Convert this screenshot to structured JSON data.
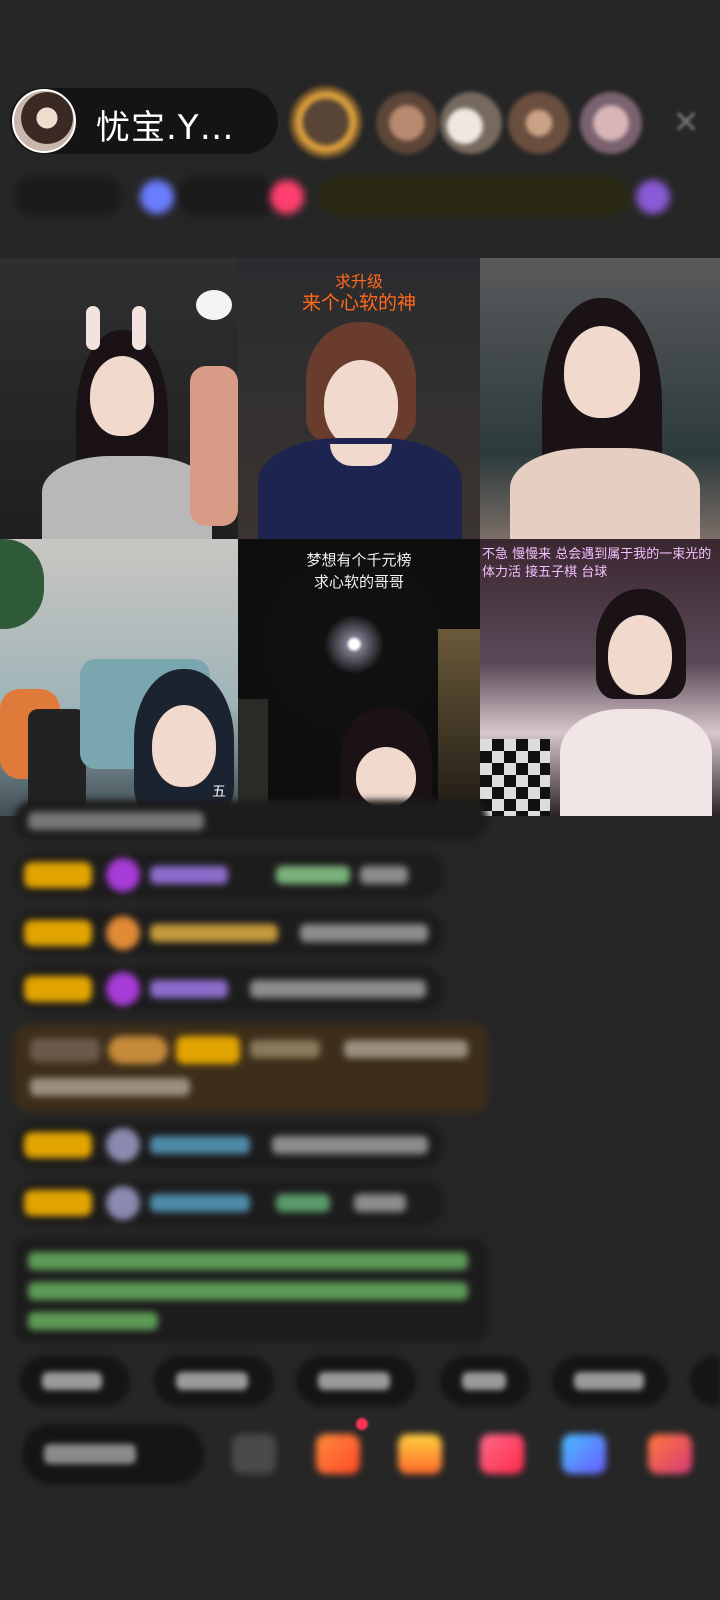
{
  "header": {
    "host_name": "忧宝.Y…",
    "close_icon": "close-icon"
  },
  "tiles": [
    {
      "id": "tile-1",
      "overlay": []
    },
    {
      "id": "tile-2",
      "overlay": [
        "求升级",
        "来个心软的神"
      ]
    },
    {
      "id": "tile-3",
      "overlay": []
    },
    {
      "id": "tile-4",
      "overlay": [
        "五"
      ]
    },
    {
      "id": "tile-5",
      "overlay": [
        "梦想有个千元榜",
        "求心软的哥哥"
      ]
    },
    {
      "id": "tile-6",
      "overlay": [
        "不急 慢慢来 总会遇到属于我的一束光的",
        "体力活 接五子棋 台球"
      ]
    }
  ],
  "colors": {
    "background": "#262626",
    "badge": "#e2a400",
    "overlay_orange": "#ff6a1a",
    "overlay_yellow": "#ffd54a",
    "overlay_purple": "#f3c1ff"
  }
}
